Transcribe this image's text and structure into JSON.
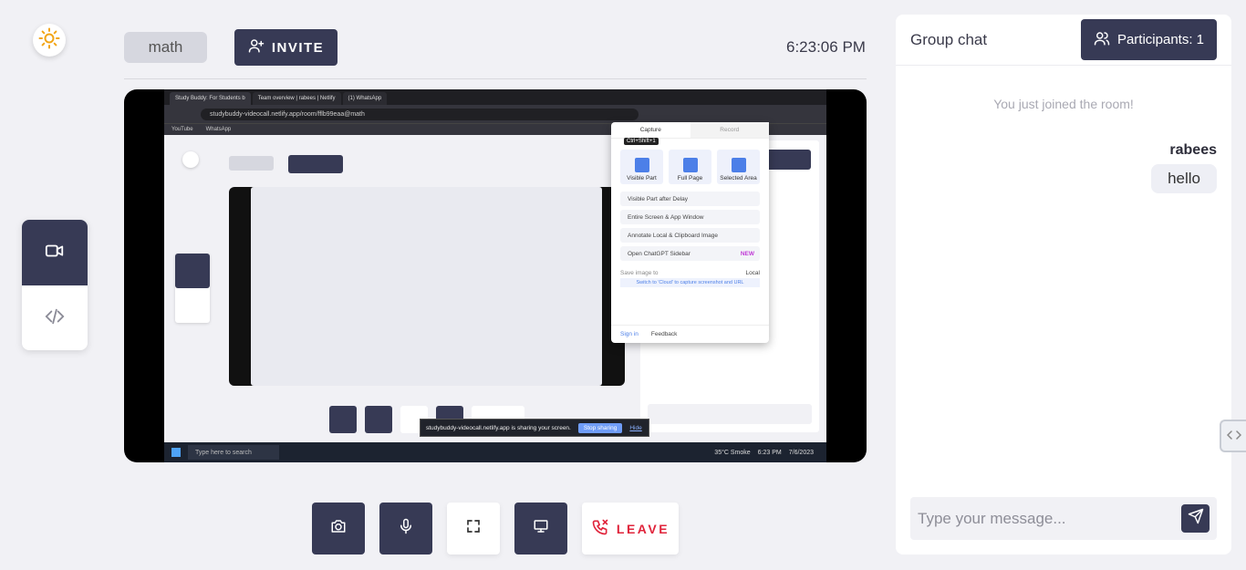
{
  "header": {
    "room_name": "math",
    "invite_label": "INVITE",
    "clock": "6:23:06 PM"
  },
  "controls": {
    "leave_label": "LEAVE"
  },
  "chat": {
    "title": "Group chat",
    "participants_label": "Participants: 1",
    "system_message": "You just joined the room!",
    "messages": [
      {
        "sender": "rabees",
        "text": "hello"
      }
    ],
    "input_placeholder": "Type your message..."
  },
  "shared_screen": {
    "tabs": [
      "Study Buddy: For Students b",
      "Team overview | rabees | Netlify",
      "(1) WhatsApp"
    ],
    "url": "studybuddy-videocall.netlify.app/room/fflb99eaa@math",
    "bookmarks": [
      "YouTube",
      "WhatsApp"
    ],
    "popup": {
      "tabs": [
        "Capture",
        "Record"
      ],
      "shortcut": "Ctrl+Shift+1",
      "tiles": [
        "Visible Part",
        "Full Page",
        "Selected Area"
      ],
      "options": [
        "Visible Part after Delay",
        "Entire Screen & App Window",
        "Annotate Local & Clipboard Image",
        "Open ChatGPT Sidebar"
      ],
      "new_badge": "NEW",
      "save_label": "Save image to",
      "save_value": "Local",
      "cloud_hint": "Switch to 'Cloud' to capture screenshot and URL",
      "sign_in": "Sign in",
      "feedback": "Feedback"
    },
    "share_text": "studybuddy-videocall.netlify.app is sharing your screen.",
    "stop_sharing": "Stop sharing",
    "hide": "Hide",
    "taskbar_search": "Type here to search",
    "weather": "35°C Smoke",
    "tray_time": "6:23 PM",
    "tray_date": "7/6/2023"
  }
}
